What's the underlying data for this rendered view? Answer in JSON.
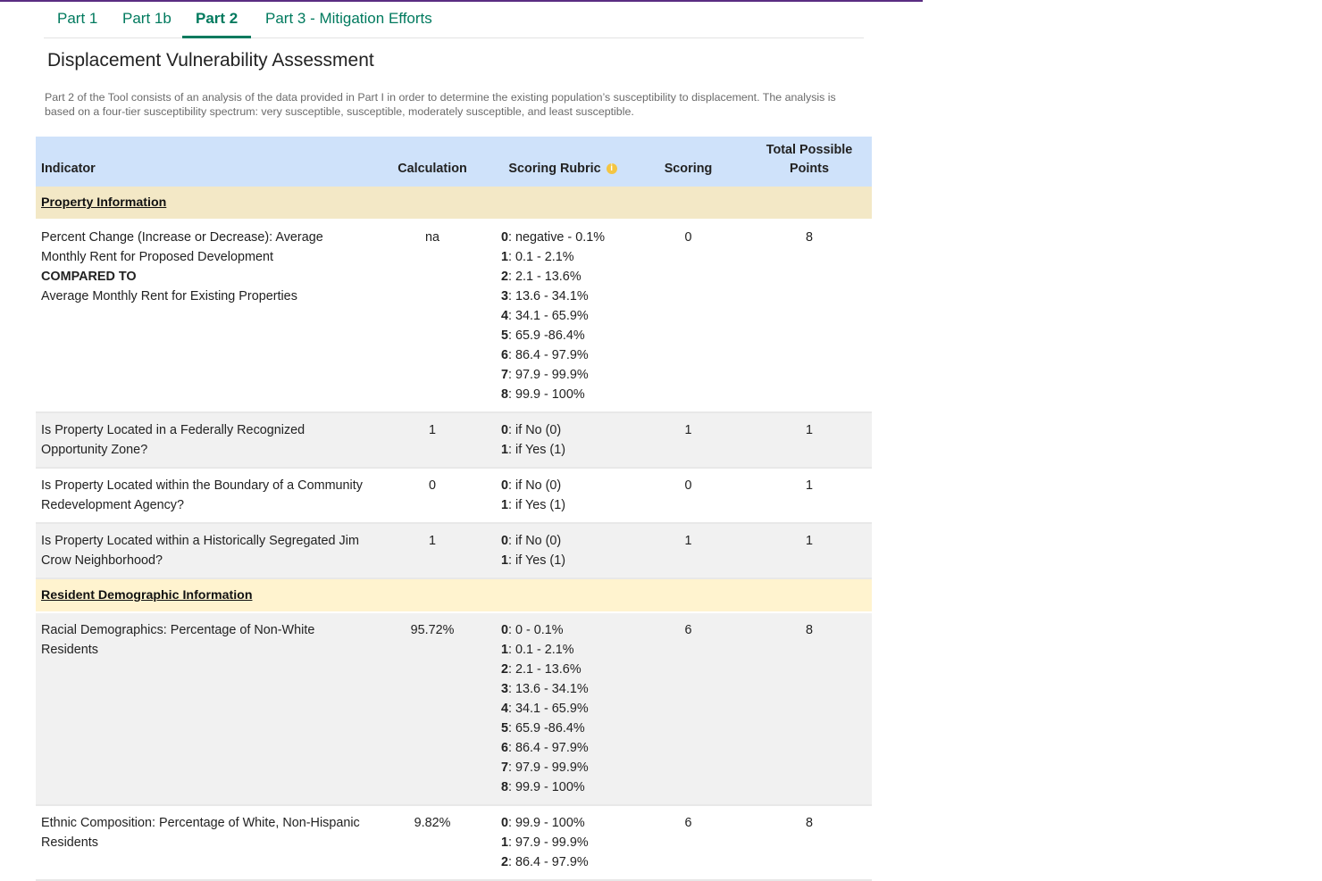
{
  "tabs": [
    {
      "label": "Part 1"
    },
    {
      "label": "Part 1b"
    },
    {
      "label": "Part 2"
    },
    {
      "label": "Part 3 - Mitigation Efforts"
    }
  ],
  "page": {
    "title": "Displacement Vulnerability Assessment",
    "description": "Part 2 of the Tool consists of an analysis of the data provided in Part I in order to determine the existing population’s susceptibility to displacement. The analysis is based on a four-tier susceptibility spectrum: very susceptible, susceptible, moderately susceptible, and least susceptible."
  },
  "table": {
    "headers": {
      "indicator": "Indicator",
      "calculation": "Calculation",
      "rubric": "Scoring Rubric",
      "scoring": "Scoring",
      "total": "Total Possible Points"
    },
    "sections": [
      {
        "title": "Property Information"
      },
      {
        "title": "Resident Demographic Information"
      }
    ],
    "rows": [
      {
        "indicator_line1": "Percent Change (Increase or Decrease): Average Monthly Rent for Proposed Development",
        "indicator_bold": "COMPARED TO",
        "indicator_line2": "Average Monthly Rent for Existing Properties",
        "calculation": "na",
        "rubric": [
          {
            "k": "0",
            "v": ": negative - 0.1%"
          },
          {
            "k": "1",
            "v": ": 0.1 - 2.1%"
          },
          {
            "k": "2",
            "v": ": 2.1 - 13.6%"
          },
          {
            "k": "3",
            "v": ": 13.6 - 34.1%"
          },
          {
            "k": "4",
            "v": ": 34.1 - 65.9%"
          },
          {
            "k": "5",
            "v": ": 65.9 -86.4%"
          },
          {
            "k": "6",
            "v": ": 86.4 - 97.9%"
          },
          {
            "k": "7",
            "v": ": 97.9 - 99.9%"
          },
          {
            "k": "8",
            "v": ": 99.9 - 100%"
          }
        ],
        "scoring": "0",
        "total": "8"
      },
      {
        "indicator": "Is Property Located in a Federally Recognized Opportunity Zone?",
        "calculation": "1",
        "rubric": [
          {
            "k": "0",
            "v": ": if No (0)"
          },
          {
            "k": "1",
            "v": ": if Yes (1)"
          }
        ],
        "scoring": "1",
        "total": "1"
      },
      {
        "indicator": "Is Property Located within the Boundary of a Community Redevelopment Agency?",
        "calculation": "0",
        "rubric": [
          {
            "k": "0",
            "v": ": if No (0)"
          },
          {
            "k": "1",
            "v": ": if Yes (1)"
          }
        ],
        "scoring": "0",
        "total": "1"
      },
      {
        "indicator": "Is Property Located within a Historically Segregated Jim Crow Neighborhood?",
        "calculation": "1",
        "rubric": [
          {
            "k": "0",
            "v": ": if No (0)"
          },
          {
            "k": "1",
            "v": ": if Yes (1)"
          }
        ],
        "scoring": "1",
        "total": "1"
      },
      {
        "indicator": "Racial Demographics: Percentage of Non-White Residents",
        "calculation": "95.72%",
        "rubric": [
          {
            "k": "0",
            "v": ": 0 - 0.1%"
          },
          {
            "k": "1",
            "v": ": 0.1 - 2.1%"
          },
          {
            "k": "2",
            "v": ": 2.1 - 13.6%"
          },
          {
            "k": "3",
            "v": ": 13.6 - 34.1%"
          },
          {
            "k": "4",
            "v": ": 34.1 - 65.9%"
          },
          {
            "k": "5",
            "v": ": 65.9 -86.4%"
          },
          {
            "k": "6",
            "v": ": 86.4 - 97.9%"
          },
          {
            "k": "7",
            "v": ": 97.9 - 99.9%"
          },
          {
            "k": "8",
            "v": ": 99.9 - 100%"
          }
        ],
        "scoring": "6",
        "total": "8"
      },
      {
        "indicator": "Ethnic Composition: Percentage of White, Non-Hispanic Residents",
        "calculation": "9.82%",
        "rubric": [
          {
            "k": "0",
            "v": ": 99.9 - 100%"
          },
          {
            "k": "1",
            "v": ": 97.9 - 99.9%"
          },
          {
            "k": "2",
            "v": ": 86.4 - 97.9%"
          }
        ],
        "scoring": "6",
        "total": "8"
      }
    ]
  },
  "colors": {
    "accent": "#007a5e",
    "header_bg": "#cfe2fa",
    "section_bg": "#f3e8c6",
    "info_icon": "#f4c542"
  }
}
